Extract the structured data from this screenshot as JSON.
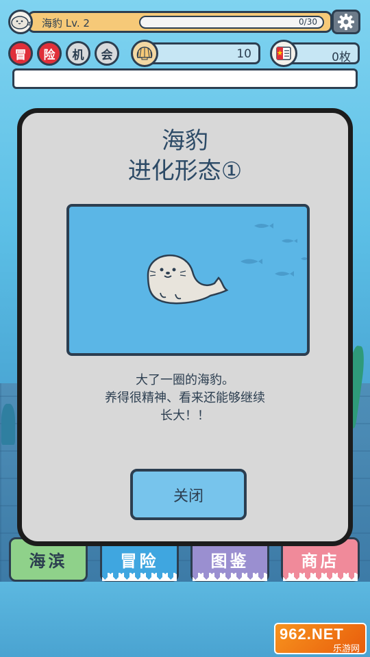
{
  "hud": {
    "player_name": "海豹 Lv. 2",
    "xp_text": "0/30",
    "xp_fraction": 0,
    "chips": [
      "冒",
      "险",
      "机",
      "会"
    ],
    "shells": "10",
    "coupons": "0枚"
  },
  "dialog": {
    "title": "海豹",
    "subtitle": "进化形态①",
    "description": [
      "大了一圈的海豹。",
      "养得很精神、看来还能够继续",
      "长大！！"
    ],
    "close_label": "关闭"
  },
  "nav": [
    {
      "label": "海滨",
      "color": "#8fd18a"
    },
    {
      "label": "冒险",
      "color": "#3fa6e0"
    },
    {
      "label": "图鉴",
      "color": "#9a8fd0"
    },
    {
      "label": "商店",
      "color": "#f08a9a"
    }
  ],
  "watermark": {
    "main": "962.NET",
    "sub": "乐游网"
  }
}
